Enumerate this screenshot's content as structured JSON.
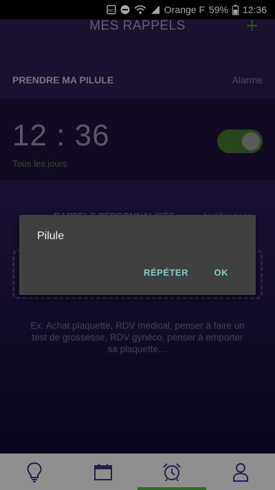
{
  "status_bar": {
    "carrier": "Orange F",
    "battery": "59%",
    "time": "12:36",
    "icons": [
      "nfc-icon",
      "do-not-disturb-icon",
      "wifi-icon",
      "signal-icon",
      "battery-icon"
    ]
  },
  "header": {
    "title": "MES RAPPELS",
    "add_symbol": "+"
  },
  "section": {
    "title": "PRENDRE MA PILULE",
    "right_label": "Alarme"
  },
  "alarm": {
    "time": "12 : 36",
    "repeat": "Tous les jours",
    "enabled": true
  },
  "tabs": [
    {
      "label": "RAPPELS PERSONNALISÉS"
    },
    {
      "label": "Notifications"
    }
  ],
  "hint": "Ex. Achat plaquette, RDV médical, penser à faire un test de grossesse, RDV gynéco, penser à emporter sa plaquette…",
  "dialog": {
    "title": "Pilule",
    "repeat_button": "RÉPÉTER",
    "ok_button": "OK"
  },
  "bottom_nav": {
    "items": [
      {
        "icon": "lightbulb-icon"
      },
      {
        "icon": "calendar-icon"
      },
      {
        "icon": "alarm-clock-icon",
        "active": true
      },
      {
        "icon": "profile-icon"
      }
    ]
  },
  "colors": {
    "accent_green": "#3e6f2a",
    "dialog_button": "#7fcfc4"
  }
}
